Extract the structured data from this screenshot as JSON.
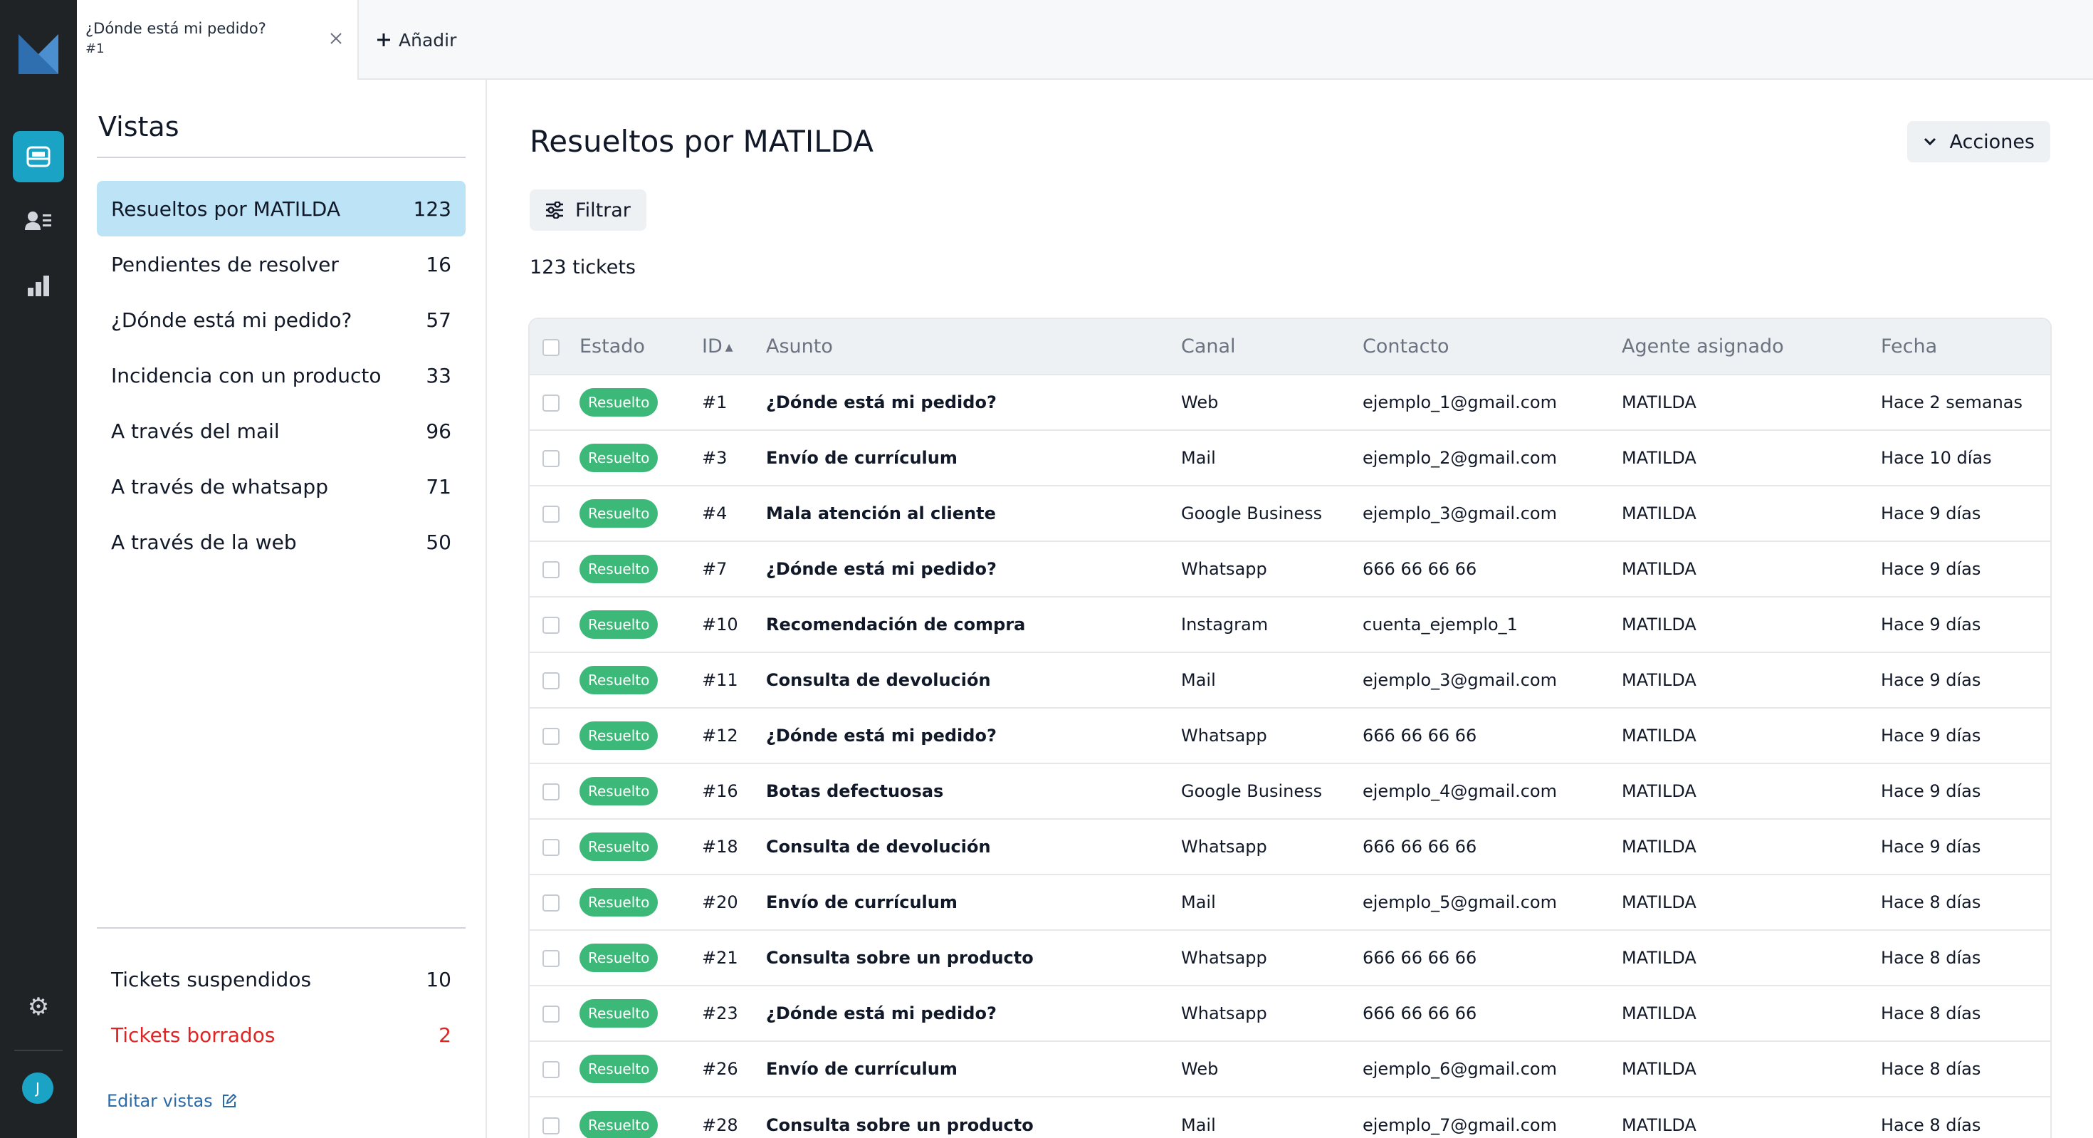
{
  "colors": {
    "rail_bg": "#1f2326",
    "accent": "#1ba3c6",
    "active_view_bg": "#bde3f6",
    "badge_green": "#3cb878",
    "deleted_red": "#e02424",
    "link_blue": "#2b6aa8"
  },
  "rail": {
    "logo": "brand-logo",
    "items": [
      {
        "icon": "inbox-icon",
        "active": true
      },
      {
        "icon": "contacts-icon",
        "active": false
      },
      {
        "icon": "bar-chart-icon",
        "active": false
      }
    ],
    "settings_icon": "gear-icon",
    "avatar_initial": "J"
  },
  "topbar": {
    "tab": {
      "title": "¿Dónde está mi pedido?",
      "subtitle": "#1"
    },
    "add_label": "Añadir"
  },
  "views": {
    "heading": "Vistas",
    "items": [
      {
        "label": "Resueltos por MATILDA",
        "count": "123",
        "active": true
      },
      {
        "label": "Pendientes de resolver",
        "count": "16"
      },
      {
        "label": "¿Dónde está mi pedido?",
        "count": "57"
      },
      {
        "label": "Incidencia con un producto",
        "count": "33"
      },
      {
        "label": "A través del mail",
        "count": "96"
      },
      {
        "label": "A través de whatsapp",
        "count": "71"
      },
      {
        "label": "A través de la web",
        "count": "50"
      }
    ],
    "bottom": [
      {
        "label": "Tickets suspendidos",
        "count": "10"
      },
      {
        "label": "Tickets borrados",
        "count": "2"
      }
    ],
    "edit_label": "Editar vistas"
  },
  "main": {
    "title": "Resueltos por MATILDA",
    "actions_label": "Acciones",
    "filter_label": "Filtrar",
    "count_label": "123 tickets",
    "columns": [
      "Estado",
      "ID",
      "Asunto",
      "Canal",
      "Contacto",
      "Agente asignado",
      "Fecha"
    ],
    "rows": [
      {
        "status": "Resuelto",
        "id": "#1",
        "subject": "¿Dónde está mi pedido?",
        "channel": "Web",
        "contact": "ejemplo_1@gmail.com",
        "agent": "MATILDA",
        "date": "Hace 2 semanas"
      },
      {
        "status": "Resuelto",
        "id": "#3",
        "subject": "Envío de currículum",
        "channel": "Mail",
        "contact": "ejemplo_2@gmail.com",
        "agent": "MATILDA",
        "date": "Hace 10 días"
      },
      {
        "status": "Resuelto",
        "id": "#4",
        "subject": "Mala atención al cliente",
        "channel": "Google Business",
        "contact": "ejemplo_3@gmail.com",
        "agent": "MATILDA",
        "date": "Hace 9 días"
      },
      {
        "status": "Resuelto",
        "id": "#7",
        "subject": "¿Dónde está mi pedido?",
        "channel": "Whatsapp",
        "contact": "666 66 66 66",
        "agent": "MATILDA",
        "date": "Hace 9 días"
      },
      {
        "status": "Resuelto",
        "id": "#10",
        "subject": "Recomendación de compra",
        "channel": "Instagram",
        "contact": "cuenta_ejemplo_1",
        "agent": "MATILDA",
        "date": "Hace 9 días"
      },
      {
        "status": "Resuelto",
        "id": "#11",
        "subject": "Consulta de devolución",
        "channel": "Mail",
        "contact": "ejemplo_3@gmail.com",
        "agent": "MATILDA",
        "date": "Hace 9 días"
      },
      {
        "status": "Resuelto",
        "id": "#12",
        "subject": "¿Dónde está mi pedido?",
        "channel": "Whatsapp",
        "contact": "666 66 66 66",
        "agent": "MATILDA",
        "date": "Hace 9 días"
      },
      {
        "status": "Resuelto",
        "id": "#16",
        "subject": "Botas defectuosas",
        "channel": "Google Business",
        "contact": "ejemplo_4@gmail.com",
        "agent": "MATILDA",
        "date": "Hace 9 días"
      },
      {
        "status": "Resuelto",
        "id": "#18",
        "subject": "Consulta de devolución",
        "channel": "Whatsapp",
        "contact": "666 66 66 66",
        "agent": "MATILDA",
        "date": "Hace 9 días"
      },
      {
        "status": "Resuelto",
        "id": "#20",
        "subject": "Envío de currículum",
        "channel": "Mail",
        "contact": "ejemplo_5@gmail.com",
        "agent": "MATILDA",
        "date": "Hace 8 días"
      },
      {
        "status": "Resuelto",
        "id": "#21",
        "subject": "Consulta sobre un producto",
        "channel": "Whatsapp",
        "contact": "666 66 66 66",
        "agent": "MATILDA",
        "date": "Hace 8 días"
      },
      {
        "status": "Resuelto",
        "id": "#23",
        "subject": "¿Dónde está mi pedido?",
        "channel": "Whatsapp",
        "contact": "666 66 66 66",
        "agent": "MATILDA",
        "date": "Hace 8 días"
      },
      {
        "status": "Resuelto",
        "id": "#26",
        "subject": "Envío de currículum",
        "channel": "Web",
        "contact": "ejemplo_6@gmail.com",
        "agent": "MATILDA",
        "date": "Hace 8 días"
      },
      {
        "status": "Resuelto",
        "id": "#28",
        "subject": "Consulta sobre un producto",
        "channel": "Mail",
        "contact": "ejemplo_7@gmail.com",
        "agent": "MATILDA",
        "date": "Hace 8 días"
      }
    ]
  }
}
